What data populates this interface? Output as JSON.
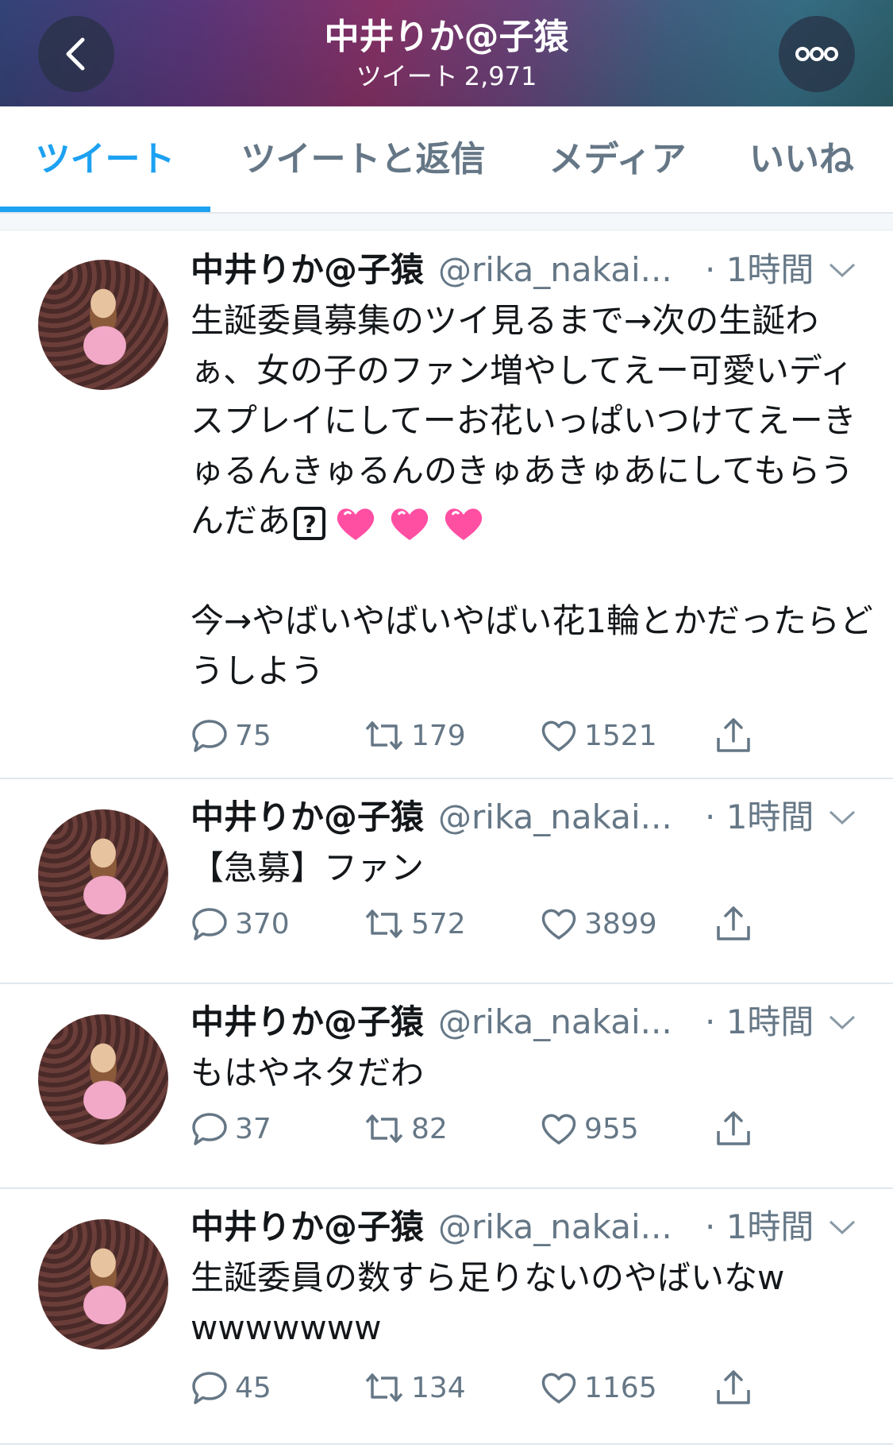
{
  "header": {
    "title": "中井りか@子猿",
    "tweets_label": "ツイート",
    "tweets_count": "2,971"
  },
  "tabs": [
    {
      "label": "ツイート",
      "active": true
    },
    {
      "label": "ツイートと返信",
      "active": false
    },
    {
      "label": "メディア",
      "active": false
    },
    {
      "label": "いいね",
      "active": false
    }
  ],
  "colors": {
    "accent": "#1da1f2",
    "secondary_text": "#657786"
  },
  "tweets": [
    {
      "name": "中井りか@子猿",
      "handle": "@rika_nakai...",
      "time": "· 1時間",
      "text_1": "生誕委員募集のツイ見るまで→次の生誕わぁ、女の子のファン増やしてえー可愛いディスプレイにしてーお花いっぱいつけてえーきゅるんきゅるんのきゅあきゅあにしてもらうんだあ",
      "emoji_question": "?",
      "text_2": "今→やばいやばいやばい花1輪とかだったらどうしよう",
      "replies": "75",
      "retweets": "179",
      "likes": "1521"
    },
    {
      "name": "中井りか@子猿",
      "handle": "@rika_nakai...",
      "time": "· 1時間",
      "text": "【急募】ファン",
      "replies": "370",
      "retweets": "572",
      "likes": "3899"
    },
    {
      "name": "中井りか@子猿",
      "handle": "@rika_nakai...",
      "time": "· 1時間",
      "text": "もはやネタだわ",
      "replies": "37",
      "retweets": "82",
      "likes": "955"
    },
    {
      "name": "中井りか@子猿",
      "handle": "@rika_nakai...",
      "time": "· 1時間",
      "text": "生誕委員の数すら足りないのやばいなwwwwwwww",
      "replies": "45",
      "retweets": "134",
      "likes": "1165"
    }
  ]
}
